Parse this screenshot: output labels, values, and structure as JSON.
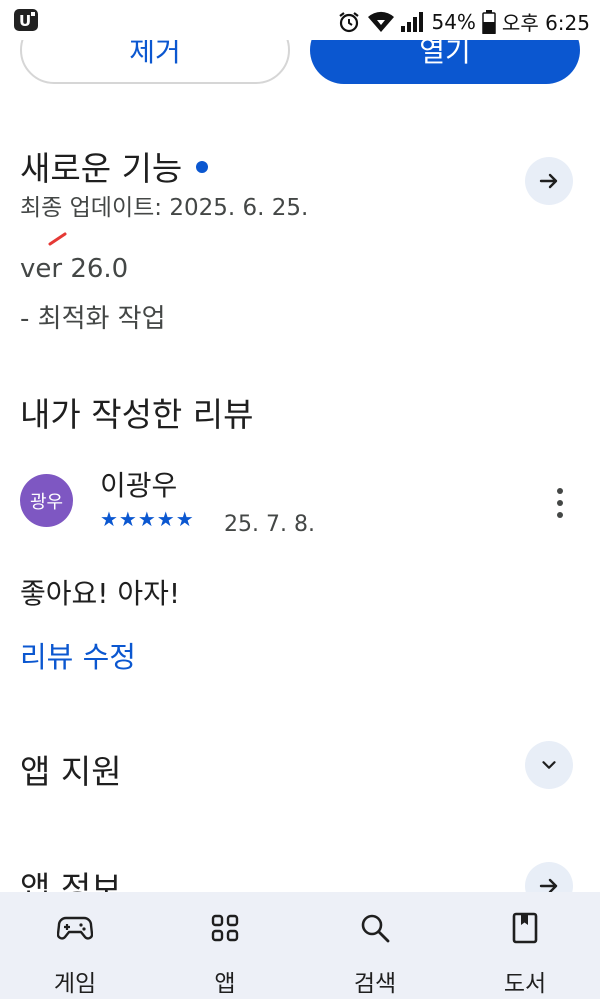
{
  "status_bar": {
    "battery": "54%",
    "time": "오후 6:25"
  },
  "actions": {
    "remove_label": "제거",
    "open_label": "열기"
  },
  "whats_new": {
    "title": "새로운 기능",
    "updated": "최종 업데이트: 2025. 6. 25.",
    "notes": [
      "ver 26.0",
      "- 최적화 작업"
    ]
  },
  "my_review": {
    "title": "내가 작성한 리뷰",
    "avatar_text": "광우",
    "reviewer": "이광우",
    "stars": "★★★★★",
    "rating": 5,
    "date": "25. 7. 8.",
    "text": "좋아요! 아자!",
    "edit_label": "리뷰 수정"
  },
  "app_support": {
    "title": "앱 지원"
  },
  "app_info": {
    "title": "앱 정보"
  },
  "bottom_nav": [
    {
      "label": "게임",
      "icon": "gamepad-icon"
    },
    {
      "label": "앱",
      "icon": "apps-grid-icon"
    },
    {
      "label": "검색",
      "icon": "search-icon"
    },
    {
      "label": "도서",
      "icon": "book-icon"
    }
  ],
  "colors": {
    "accent": "#0b57d0",
    "avatar": "#7e57c2",
    "nav_bg": "#edf0f7",
    "round_button_bg": "#e8eef7"
  }
}
